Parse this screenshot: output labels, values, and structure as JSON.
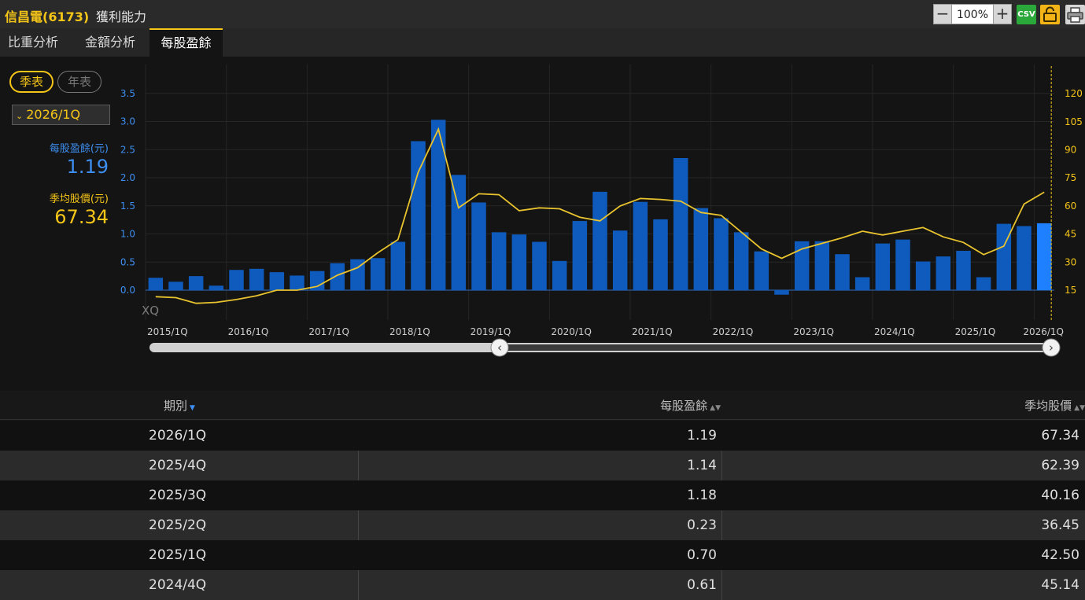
{
  "header": {
    "stock": "信昌電(6173)",
    "section": "獲利能力",
    "zoom_minus": "−",
    "zoom_value": "100%",
    "zoom_plus": "+",
    "csv_label": "CSV"
  },
  "tabs": [
    {
      "label": "比重分析"
    },
    {
      "label": "金額分析"
    },
    {
      "label": "每股盈餘"
    }
  ],
  "sidebar": {
    "quarterly_label": "季表",
    "annual_label": "年表",
    "period_value": "2026/1Q",
    "eps_label": "每股盈餘(元)",
    "eps_value": "1.19",
    "price_label": "季均股價(元)",
    "price_value": "67.34"
  },
  "chart_data": {
    "type": "bar",
    "watermark": "XQ",
    "left_ticks": [
      "0.0",
      "0.5",
      "1.0",
      "1.5",
      "2.0",
      "2.5",
      "3.0",
      "3.5"
    ],
    "right_ticks": [
      "15",
      "30",
      "45",
      "60",
      "75",
      "90",
      "105",
      "120"
    ],
    "y_left_range": [
      -0.3,
      3.9
    ],
    "y_right_range": [
      8,
      125
    ],
    "x_labels": [
      "2015/1Q",
      "2016/1Q",
      "2017/1Q",
      "2018/1Q",
      "2019/1Q",
      "2020/1Q",
      "2021/1Q",
      "2022/1Q",
      "2023/1Q",
      "2024/1Q",
      "2025/1Q",
      "2026/1Q"
    ],
    "colors": {
      "eps": "#0f5bbd",
      "eps_highlight": "#1e7fff",
      "price": "#e8c32e",
      "grid": "#262626",
      "cursor": "#f5c518"
    },
    "series": [
      {
        "name": "每股盈餘",
        "values": [
          0.22,
          0.15,
          0.25,
          0.08,
          0.36,
          0.38,
          0.32,
          0.26,
          0.34,
          0.48,
          0.55,
          0.57,
          0.86,
          2.65,
          3.03,
          2.05,
          1.56,
          1.03,
          0.99,
          0.86,
          0.52,
          1.23,
          1.75,
          1.06,
          1.57,
          1.26,
          2.35,
          1.46,
          1.28,
          1.03,
          0.69,
          -0.08,
          0.87,
          0.87,
          0.64,
          0.23,
          0.83,
          0.9,
          0.51,
          0.6,
          0.7,
          0.23,
          1.18,
          1.14,
          1.19
        ]
      },
      {
        "name": "季均股價",
        "values": [
          11.5,
          11,
          8,
          8.5,
          10,
          12,
          15,
          15,
          17,
          23,
          27,
          35,
          42,
          78,
          101,
          59,
          66.5,
          66,
          57.5,
          59,
          58.5,
          54,
          52,
          60,
          64,
          63.5,
          62.5,
          56.5,
          55,
          46,
          37,
          32,
          37,
          40,
          43,
          46.5,
          44.5,
          46.5,
          48.5,
          43.5,
          40.5,
          34,
          38.5,
          61,
          67.34
        ]
      }
    ]
  },
  "table": {
    "headers": {
      "period": "期別",
      "eps": "每股盈餘",
      "price": "季均股價"
    },
    "sort_icon": "▲▼",
    "rows": [
      {
        "period": "2026/1Q",
        "eps": "1.19",
        "price": "67.34"
      },
      {
        "period": "2025/4Q",
        "eps": "1.14",
        "price": "62.39"
      },
      {
        "period": "2025/3Q",
        "eps": "1.18",
        "price": "40.16"
      },
      {
        "period": "2025/2Q",
        "eps": "0.23",
        "price": "36.45"
      },
      {
        "period": "2025/1Q",
        "eps": "0.70",
        "price": "42.50"
      },
      {
        "period": "2024/4Q",
        "eps": "0.61",
        "price": "45.14"
      }
    ]
  }
}
